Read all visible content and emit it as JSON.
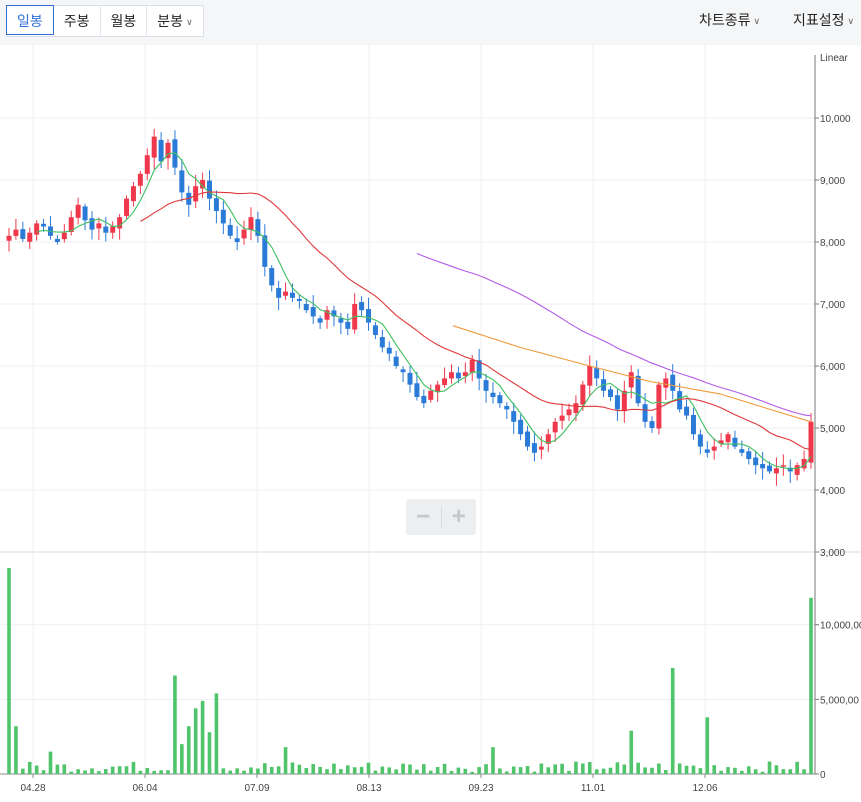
{
  "tabs": [
    {
      "label": "일봉",
      "active": true
    },
    {
      "label": "주봉",
      "active": false
    },
    {
      "label": "월봉",
      "active": false
    },
    {
      "label": "분봉",
      "active": false,
      "dropdown": true
    }
  ],
  "menus": {
    "chart_type": "차트종류",
    "indicator_settings": "지표설정"
  },
  "icons": {
    "dropdown": "chevron-down-icon",
    "zoom_out": "minus-icon",
    "zoom_in": "plus-icon"
  },
  "colors": {
    "up": "#f0384d",
    "down": "#2a7ad8",
    "ma5": "#3fbf5f",
    "ma20": "#e0383a",
    "ma60": "#b35be8",
    "ma120": "#f09a3c",
    "volume": "#4fc46a",
    "active_tab": "#2f6fd6"
  },
  "chart_data": [
    {
      "type": "candlestick",
      "scale_label": "Linear",
      "y_ticks": [
        3000,
        4000,
        5000,
        6000,
        7000,
        8000,
        9000,
        10000
      ],
      "y_tick_labels": [
        "3,000",
        "4,000",
        "5,000",
        "6,000",
        "7,000",
        "8,000",
        "9,000",
        "10,000"
      ],
      "ylim": [
        3000,
        10800
      ],
      "x_tick_labels": [
        "04.28",
        "06.04",
        "07.09",
        "08.13",
        "09.23",
        "11.01",
        "12.06"
      ],
      "grid": true,
      "close_approx": [
        8100,
        8200,
        8050,
        8150,
        8300,
        8250,
        8100,
        8000,
        8150,
        8400,
        8600,
        8350,
        8200,
        8300,
        8150,
        8250,
        8400,
        8700,
        8900,
        9100,
        9400,
        9700,
        9300,
        9600,
        9200,
        8800,
        8600,
        8900,
        9000,
        8700,
        8500,
        8300,
        8100,
        8000,
        8200,
        8400,
        8100,
        7600,
        7300,
        7100,
        7200,
        7100,
        7050,
        6900,
        6800,
        6700,
        6900,
        6800,
        6700,
        6600,
        7000,
        6900,
        6700,
        6500,
        6300,
        6200,
        6000,
        5900,
        5700,
        5500,
        5400,
        5600,
        5700,
        5800,
        5900,
        5800,
        5900,
        6100,
        5800,
        5600,
        5500,
        5400,
        5300,
        5100,
        4900,
        4700,
        4600,
        4700,
        4900,
        5100,
        5200,
        5300,
        5400,
        5700,
        6000,
        5800,
        5600,
        5500,
        5300,
        5600,
        5900,
        5400,
        5100,
        5000,
        5700,
        5800,
        5600,
        5300,
        5200,
        4900,
        4700,
        4600,
        4700,
        4800,
        4900,
        4700,
        4600,
        4500,
        4400,
        4350,
        4300,
        4350,
        4400,
        4300,
        4400,
        4500,
        5100
      ]
    },
    {
      "type": "bar",
      "series_kind": "volume",
      "y_ticks": [
        0,
        5000000,
        10000000
      ],
      "y_tick_labels": [
        "0",
        "5,000,00",
        "10,000,00"
      ],
      "peak_values": {
        "first": 13800000,
        "june": [
          6600000,
          5400000,
          4900000
        ],
        "mid_november": 7100000,
        "last": 11800000
      }
    }
  ]
}
